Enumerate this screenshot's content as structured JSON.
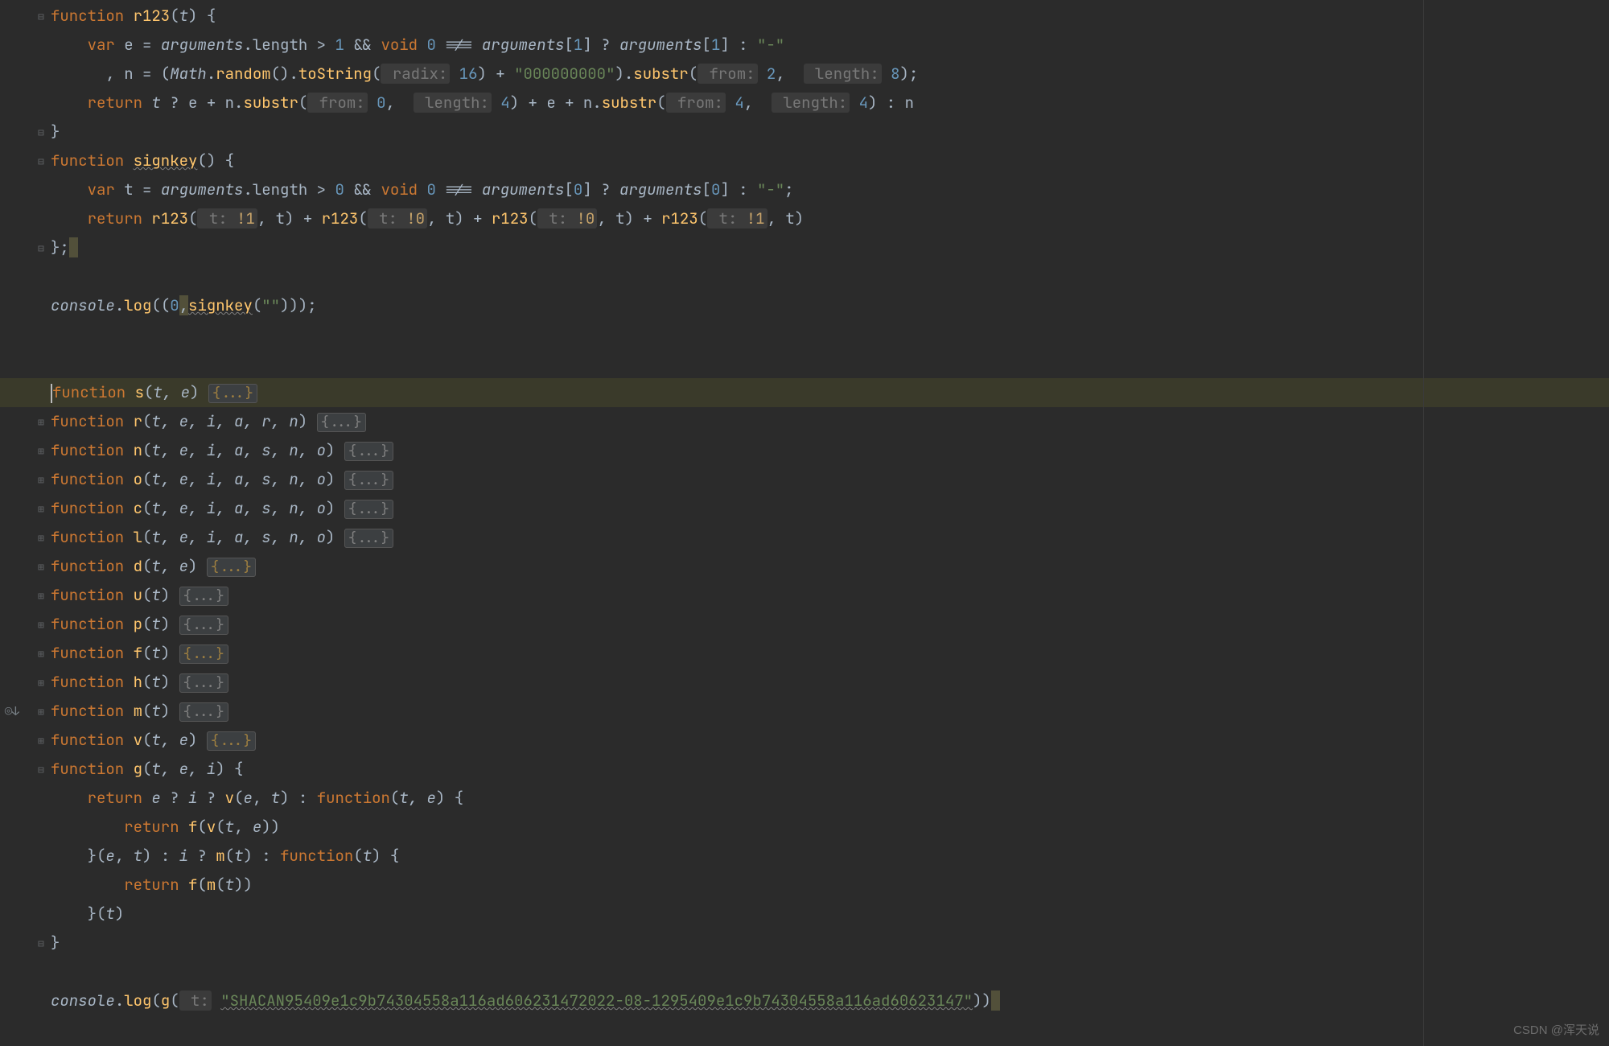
{
  "watermark": "CSDN @浑天说",
  "gutter": {
    "method_icon": "◎↓"
  },
  "lines": {
    "l1": {
      "kw1": "function",
      "fn": "r123",
      "lp": "(",
      "p": "t",
      "rp": ") {"
    },
    "l2": {
      "kw1": "var",
      "v": "e",
      "eq": " = ",
      "a1": "arguments",
      "dot": ".",
      "len": "length",
      "rest1": " > ",
      "n1": "1",
      "mid": " && ",
      "kw2": "void",
      "sp": " ",
      "n0": "0",
      "neq": " !== ",
      "a2": "arguments",
      "lb": "[",
      "n1b": "1",
      "rb": "] ? ",
      "a3": "arguments",
      "lb2": "[",
      "n1c": "1",
      "rb2": "] : ",
      "s": "\"-\""
    },
    "l3": {
      "lead": ", n = (",
      "m": "Math",
      "dot": ".",
      "rnd": "random",
      "p": "().",
      "ts": "toString",
      "lp": "(",
      "h1": " radix:",
      "hv1": " 16",
      "rp": ") + ",
      "s": "\"000000000\"",
      "rp2": ").",
      "sub": "substr",
      "lp2": "(",
      "h2": " from:",
      "hv2": " 2",
      "comma": ",  ",
      "h3": " length:",
      "hv3": " 8",
      "rp3": ");"
    },
    "l4": {
      "kw": "return",
      "sp": " ",
      "t": "t",
      "q": " ? ",
      "e": "e",
      "plus": " + ",
      "n": "n",
      "dot": ".",
      "sub": "substr",
      "lp": "(",
      "h1": " from:",
      "hv1": " 0",
      "comma": ",  ",
      "h2": " length:",
      "hv2": " 4",
      "rp": ") + ",
      "e2": "e",
      "plus2": " + ",
      "n2": "n",
      "dot2": ".",
      "sub2": "substr",
      "lp2": "(",
      "h3": " from:",
      "hv3": " 4",
      "comma2": ",  ",
      "h4": " length:",
      "hv4": " 4",
      "rp2": ") : ",
      "n3": "n"
    },
    "l5": {
      "cb": "}"
    },
    "l6": {
      "kw": "function",
      "fn": "signkey",
      "pp": "() {"
    },
    "l7": {
      "kw": "var",
      "v": " t = ",
      "a1": "arguments",
      "dot": ".",
      "len": "length",
      "gt": " > ",
      "n0": "0",
      "mid": " && ",
      "kwv": "void",
      "sp": " ",
      "n0b": "0",
      "neq": " !== ",
      "a2": "arguments",
      "lb": "[",
      "n0c": "0",
      "rb": "] ? ",
      "a3": "arguments",
      "lb2": "[",
      "n0d": "0",
      "rb2": "] : ",
      "s": "\"-\"",
      "semi": ";"
    },
    "l8": {
      "kw": "return",
      "sp": " ",
      "f1": "r123",
      "lp1": "(",
      "h1": " t:",
      "hv1": " !1",
      "c1": ", t) + ",
      "f2": "r123",
      "lp2": "(",
      "h2": " t:",
      "hv2": " !0",
      "c2": ", t) + ",
      "f3": "r123",
      "lp3": "(",
      "h3": " t:",
      "hv3": " !0",
      "c3": ", t) + ",
      "f4": "r123",
      "lp4": "(",
      "h4": " t:",
      "hv4": " !1",
      "c4": ", t)"
    },
    "l9": {
      "cb": "};"
    },
    "l11": {
      "c": "console",
      "dot": ".",
      "log": "log",
      "lp": "((",
      "n": "0",
      ",": ",",
      "w": "",
      "fn": "signkey",
      "a": "(",
      "s": "\"\"",
      "rp": ")));"
    },
    "l14": {
      "kw": "function",
      "fn": "s",
      "lp": "(",
      "p": "t, e",
      "rp": ") ",
      "fold": "{...}"
    },
    "l15": {
      "kw": "function",
      "fn": "r",
      "lp": "(",
      "p": "t, e, i, a, r, n",
      "rp": ") ",
      "fold": "{...}"
    },
    "l16": {
      "kw": "function",
      "fn": "n",
      "lp": "(",
      "p": "t, e, i, a, s, n, o",
      "rp": ") ",
      "fold": "{...}"
    },
    "l17": {
      "kw": "function",
      "fn": "o",
      "lp": "(",
      "p": "t, e, i, a, s, n, o",
      "rp": ") ",
      "fold": "{...}"
    },
    "l18": {
      "kw": "function",
      "fn": "c",
      "lp": "(",
      "p": "t, e, i, a, s, n, o",
      "rp": ") ",
      "fold": "{...}"
    },
    "l19": {
      "kw": "function",
      "fn": "l",
      "lp": "(",
      "p": "t, e, i, a, s, n, o",
      "rp": ") ",
      "fold": "{...}"
    },
    "l20": {
      "kw": "function",
      "fn": "d",
      "lp": "(",
      "p": "t, e",
      "rp": ") ",
      "fold": "{...}"
    },
    "l21": {
      "kw": "function",
      "fn": "u",
      "lp": "(",
      "p": "t",
      "rp": ") ",
      "fold": "{...}"
    },
    "l22": {
      "kw": "function",
      "fn": "p",
      "lp": "(",
      "p": "t",
      "rp": ") ",
      "fold": "{...}"
    },
    "l23": {
      "kw": "function",
      "fn": "f",
      "lp": "(",
      "p": "t",
      "rp": ") ",
      "fold": "{...}"
    },
    "l24": {
      "kw": "function",
      "fn": "h",
      "lp": "(",
      "p": "t",
      "rp": ") ",
      "fold": "{...}"
    },
    "l25": {
      "kw": "function",
      "fn": "m",
      "lp": "(",
      "p": "t",
      "rp": ") ",
      "fold": "{...}"
    },
    "l26": {
      "kw": "function",
      "fn": "v",
      "lp": "(",
      "p": "t, e",
      "rp": ") ",
      "fold": "{...}"
    },
    "l27": {
      "kw": "function",
      "fn": "g",
      "lp": "(",
      "p": "t, e, i",
      "rp": ") {"
    },
    "l28": {
      "kw": "return",
      "sp": " ",
      "e": "e",
      "q": " ? ",
      "i": "i",
      "q2": " ? ",
      "v": "v",
      "vp": "(",
      "ve": "e",
      "vc": ", ",
      "vt": "t",
      "vrp": ") : ",
      "fk": "function",
      "fp": "(",
      "pp": "t, e",
      "fprp": ") {"
    },
    "l29": {
      "kw": "return",
      "sp": " ",
      "f": "f",
      "lp": "(",
      "v": "v",
      "vp": "(",
      "t": "t",
      "c": ", ",
      "e": "e",
      "rp": "))"
    },
    "l30": {
      "cb": "}(",
      "e": "e",
      "c": ", ",
      "t": "t",
      "rp": ") : ",
      "i": "i",
      "q": " ? ",
      "m": "m",
      "mp": "(",
      "mt": "t",
      "mrp": ") : ",
      "fk": "function",
      "fp": "(",
      "pp": "t",
      "fprp": ") {"
    },
    "l31": {
      "kw": "return",
      "sp": " ",
      "f": "f",
      "lp": "(",
      "m": "m",
      "mp": "(",
      "t": "t",
      "rp": "))"
    },
    "l32": {
      "cb": "}(",
      "t": "t",
      "rp": ")"
    },
    "l33": {
      "cb": "}"
    },
    "l35": {
      "c": "console",
      "dot": ".",
      "log": "log",
      "lp": "(",
      "g": "g",
      "gp": "(",
      "h": " t:",
      "sp": " ",
      "s": "\"SHACAN95409e1c9b74304558a116ad606231472022-08-1295409e1c9b74304558a116ad60623147\"",
      "rp": "))"
    }
  }
}
